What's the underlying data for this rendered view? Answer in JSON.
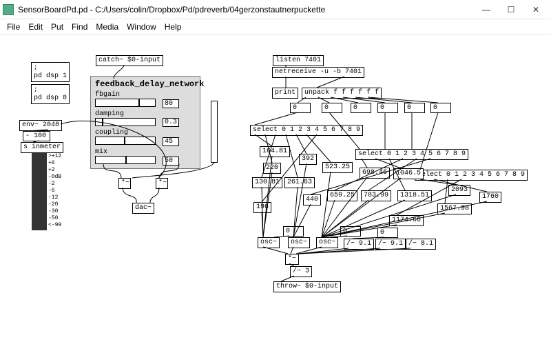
{
  "titlebar": {
    "title": "SensorBoardPd.pd  - C:/Users/colin/Dropbox/Pd/pdreverb/04gerzonstautnerpuckette",
    "min": "—",
    "max": "☐",
    "close": "✕"
  },
  "menubar": [
    "File",
    "Edit",
    "Put",
    "Find",
    "Media",
    "Window",
    "Help"
  ],
  "left": {
    "dsp1": "pd dsp 1",
    "dsp0": "pd dsp 0",
    "env": "env~ 2048",
    "num100": "- 100",
    "inmeter": "s inmeter",
    "vu_labels": [
      ">+12",
      "+6",
      "+2",
      "-0dB",
      "-2",
      "-6",
      "-12",
      "-20",
      "-30",
      "-50",
      "<-99"
    ]
  },
  "fdn": {
    "catch": "catch~ $0-input",
    "title": "feedback_delay_network",
    "rows": {
      "fbgain": {
        "label": "fbgain",
        "value": "80",
        "knob_pct": 72
      },
      "damping": {
        "label": "damping",
        "value": "0.3",
        "knob_pct": 10
      },
      "coupling": {
        "label": "coupling",
        "value": "45",
        "knob_pct": 48
      },
      "mix": {
        "label": "mix",
        "value": "50",
        "knob_pct": 50
      }
    },
    "mul_l": "*~",
    "mul_r": "*~",
    "dac": "dac~"
  },
  "net": {
    "listen": "listen 7401",
    "netreceive": "netreceive -u -b 7401",
    "print": "print",
    "unpack": "unpack f f f f f f",
    "zero": "0",
    "select1": "select 0 1 2 3 4 5 6 7 8 9",
    "select2": "select 0 1 2 3 4 5 6 7 8 9",
    "select3": "select 0 1 2 3 4 5 6 7 8 9",
    "freqs": {
      "a": "164.81",
      "b": "220",
      "c": "130.81",
      "d": "261.63",
      "e": "196",
      "f": "392",
      "g": "523.25",
      "h": "440",
      "i": "659.25",
      "j": "698.46",
      "k": "783.99",
      "l": "1046.5",
      "m": "1318.51",
      "n": "2093",
      "o": "1174.66",
      "p": "1567.98",
      "q": "1760"
    },
    "osc": "osc~",
    "divs": {
      "a": "/~ 9.1",
      "b": "/~ 9.1",
      "c": "/~ 8.1"
    },
    "mul": "*~",
    "div3": "/~ 3",
    "throw": "throw~ $0-input"
  }
}
